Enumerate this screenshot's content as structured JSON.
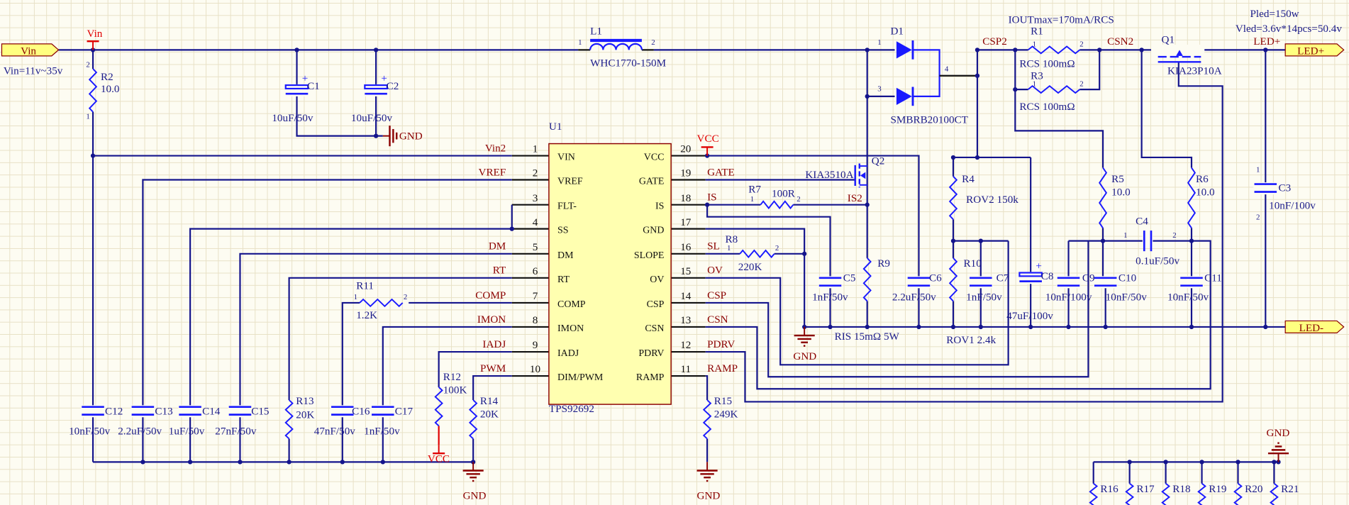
{
  "notes": {
    "vin_range": "Vin=11v~35v",
    "iout": "IOUTmax=170mA/RCS",
    "pled": "Pled=150w",
    "vled": "Vled=3.6v*14pcs=50.4v"
  },
  "ports": {
    "vin": "Vin",
    "led_plus": "LED+",
    "led_minus": "LED-"
  },
  "power": {
    "vin": "Vin",
    "vcc": "VCC",
    "gnd": "GND"
  },
  "pin_marks": {
    "one": "1",
    "two": "2",
    "three": "3",
    "four": "4"
  },
  "nets": {
    "is2": "IS2",
    "csp2": "CSP2",
    "csn2": "CSN2",
    "led_plus": "LED+"
  },
  "u1": {
    "ref": "U1",
    "part": "TPS92692",
    "left_pins": [
      {
        "num": "1",
        "name": "VIN",
        "net": "Vin2"
      },
      {
        "num": "2",
        "name": "VREF",
        "net": "VREF"
      },
      {
        "num": "3",
        "name": "FLT-",
        "net": ""
      },
      {
        "num": "4",
        "name": "SS",
        "net": ""
      },
      {
        "num": "5",
        "name": "DM",
        "net": "DM"
      },
      {
        "num": "6",
        "name": "RT",
        "net": "RT"
      },
      {
        "num": "7",
        "name": "COMP",
        "net": "COMP"
      },
      {
        "num": "8",
        "name": "IMON",
        "net": "IMON"
      },
      {
        "num": "9",
        "name": "IADJ",
        "net": "IADJ"
      },
      {
        "num": "10",
        "name": "DIM/PWM",
        "net": "PWM"
      }
    ],
    "right_pins": [
      {
        "num": "20",
        "name": "VCC",
        "net": ""
      },
      {
        "num": "19",
        "name": "GATE",
        "net": "GATE"
      },
      {
        "num": "18",
        "name": "IS",
        "net": "IS"
      },
      {
        "num": "17",
        "name": "GND",
        "net": ""
      },
      {
        "num": "16",
        "name": "SLOPE",
        "net": "SL"
      },
      {
        "num": "15",
        "name": "OV",
        "net": "OV"
      },
      {
        "num": "14",
        "name": "CSP",
        "net": "CSP"
      },
      {
        "num": "13",
        "name": "CSN",
        "net": "CSN"
      },
      {
        "num": "12",
        "name": "PDRV",
        "net": "PDRV"
      },
      {
        "num": "11",
        "name": "RAMP",
        "net": "RAMP"
      }
    ]
  },
  "components": {
    "R2": {
      "ref": "R2",
      "value": "10.0"
    },
    "C1": {
      "ref": "C1",
      "value": "10uF/50v"
    },
    "C2": {
      "ref": "C2",
      "value": "10uF/50v"
    },
    "L1": {
      "ref": "L1",
      "value": "WHC1770-150M"
    },
    "D1": {
      "ref": "D1",
      "value": "SMBRB20100CT"
    },
    "R1": {
      "ref": "R1",
      "value": "RCS 100mΩ"
    },
    "R3": {
      "ref": "R3",
      "value": "RCS 100mΩ"
    },
    "Q1": {
      "ref": "Q1",
      "value": "KIA23P10A"
    },
    "Q2": {
      "ref": "Q2",
      "value": "KIA3510A"
    },
    "R7": {
      "ref": "R7",
      "value": "100R"
    },
    "R8": {
      "ref": "R8",
      "value": "220K"
    },
    "C5": {
      "ref": "C5",
      "value": "1nF/50v"
    },
    "R9": {
      "ref": "R9",
      "value": "RIS 15mΩ 5W"
    },
    "C6": {
      "ref": "C6",
      "value": "2.2uF/50v"
    },
    "R4": {
      "ref": "R4",
      "value": "ROV2 150k"
    },
    "R10": {
      "ref": "R10",
      "value": "ROV1 2.4k"
    },
    "C7": {
      "ref": "C7",
      "value": "1nF/50v"
    },
    "C8": {
      "ref": "C8",
      "value": "47uF/100v"
    },
    "C9": {
      "ref": "C9",
      "value": "10nF/100v"
    },
    "C10": {
      "ref": "C10",
      "value": "10nF/50v"
    },
    "C11": {
      "ref": "C11",
      "value": "10nF/50v"
    },
    "C4": {
      "ref": "C4",
      "value": "0.1uF/50v"
    },
    "R5": {
      "ref": "R5",
      "value": "10.0"
    },
    "R6": {
      "ref": "R6",
      "value": "10.0"
    },
    "C3": {
      "ref": "C3",
      "value": "10nF/100v"
    },
    "R11": {
      "ref": "R11",
      "value": "1.2K"
    },
    "C12": {
      "ref": "C12",
      "value": "10nF/50v"
    },
    "C13": {
      "ref": "C13",
      "value": "2.2uF/50v"
    },
    "C14": {
      "ref": "C14",
      "value": "1uF/50v"
    },
    "C15": {
      "ref": "C15",
      "value": "27nF/50v"
    },
    "R13": {
      "ref": "R13",
      "value": "20K"
    },
    "C16": {
      "ref": "C16",
      "value": "47nF/50v"
    },
    "C17": {
      "ref": "C17",
      "value": "1nF/50v"
    },
    "R12": {
      "ref": "R12",
      "value": "100K"
    },
    "R14": {
      "ref": "R14",
      "value": "20K"
    },
    "R15": {
      "ref": "R15",
      "value": "249K"
    },
    "R16": {
      "ref": "R16"
    },
    "R17": {
      "ref": "R17"
    },
    "R18": {
      "ref": "R18"
    },
    "R19": {
      "ref": "R19"
    },
    "R20": {
      "ref": "R20"
    },
    "R21": {
      "ref": "R21"
    }
  },
  "colors": {
    "wire": "#14148c",
    "component": "#1a1aff",
    "net_label": "#8b0000",
    "power_label": "#e00000",
    "ic_fill": "#ffffb0",
    "ic_border": "#8b0000",
    "port_fill": "#ffff80",
    "grid": "#e8e1c6",
    "background": "#fdfcf2"
  }
}
